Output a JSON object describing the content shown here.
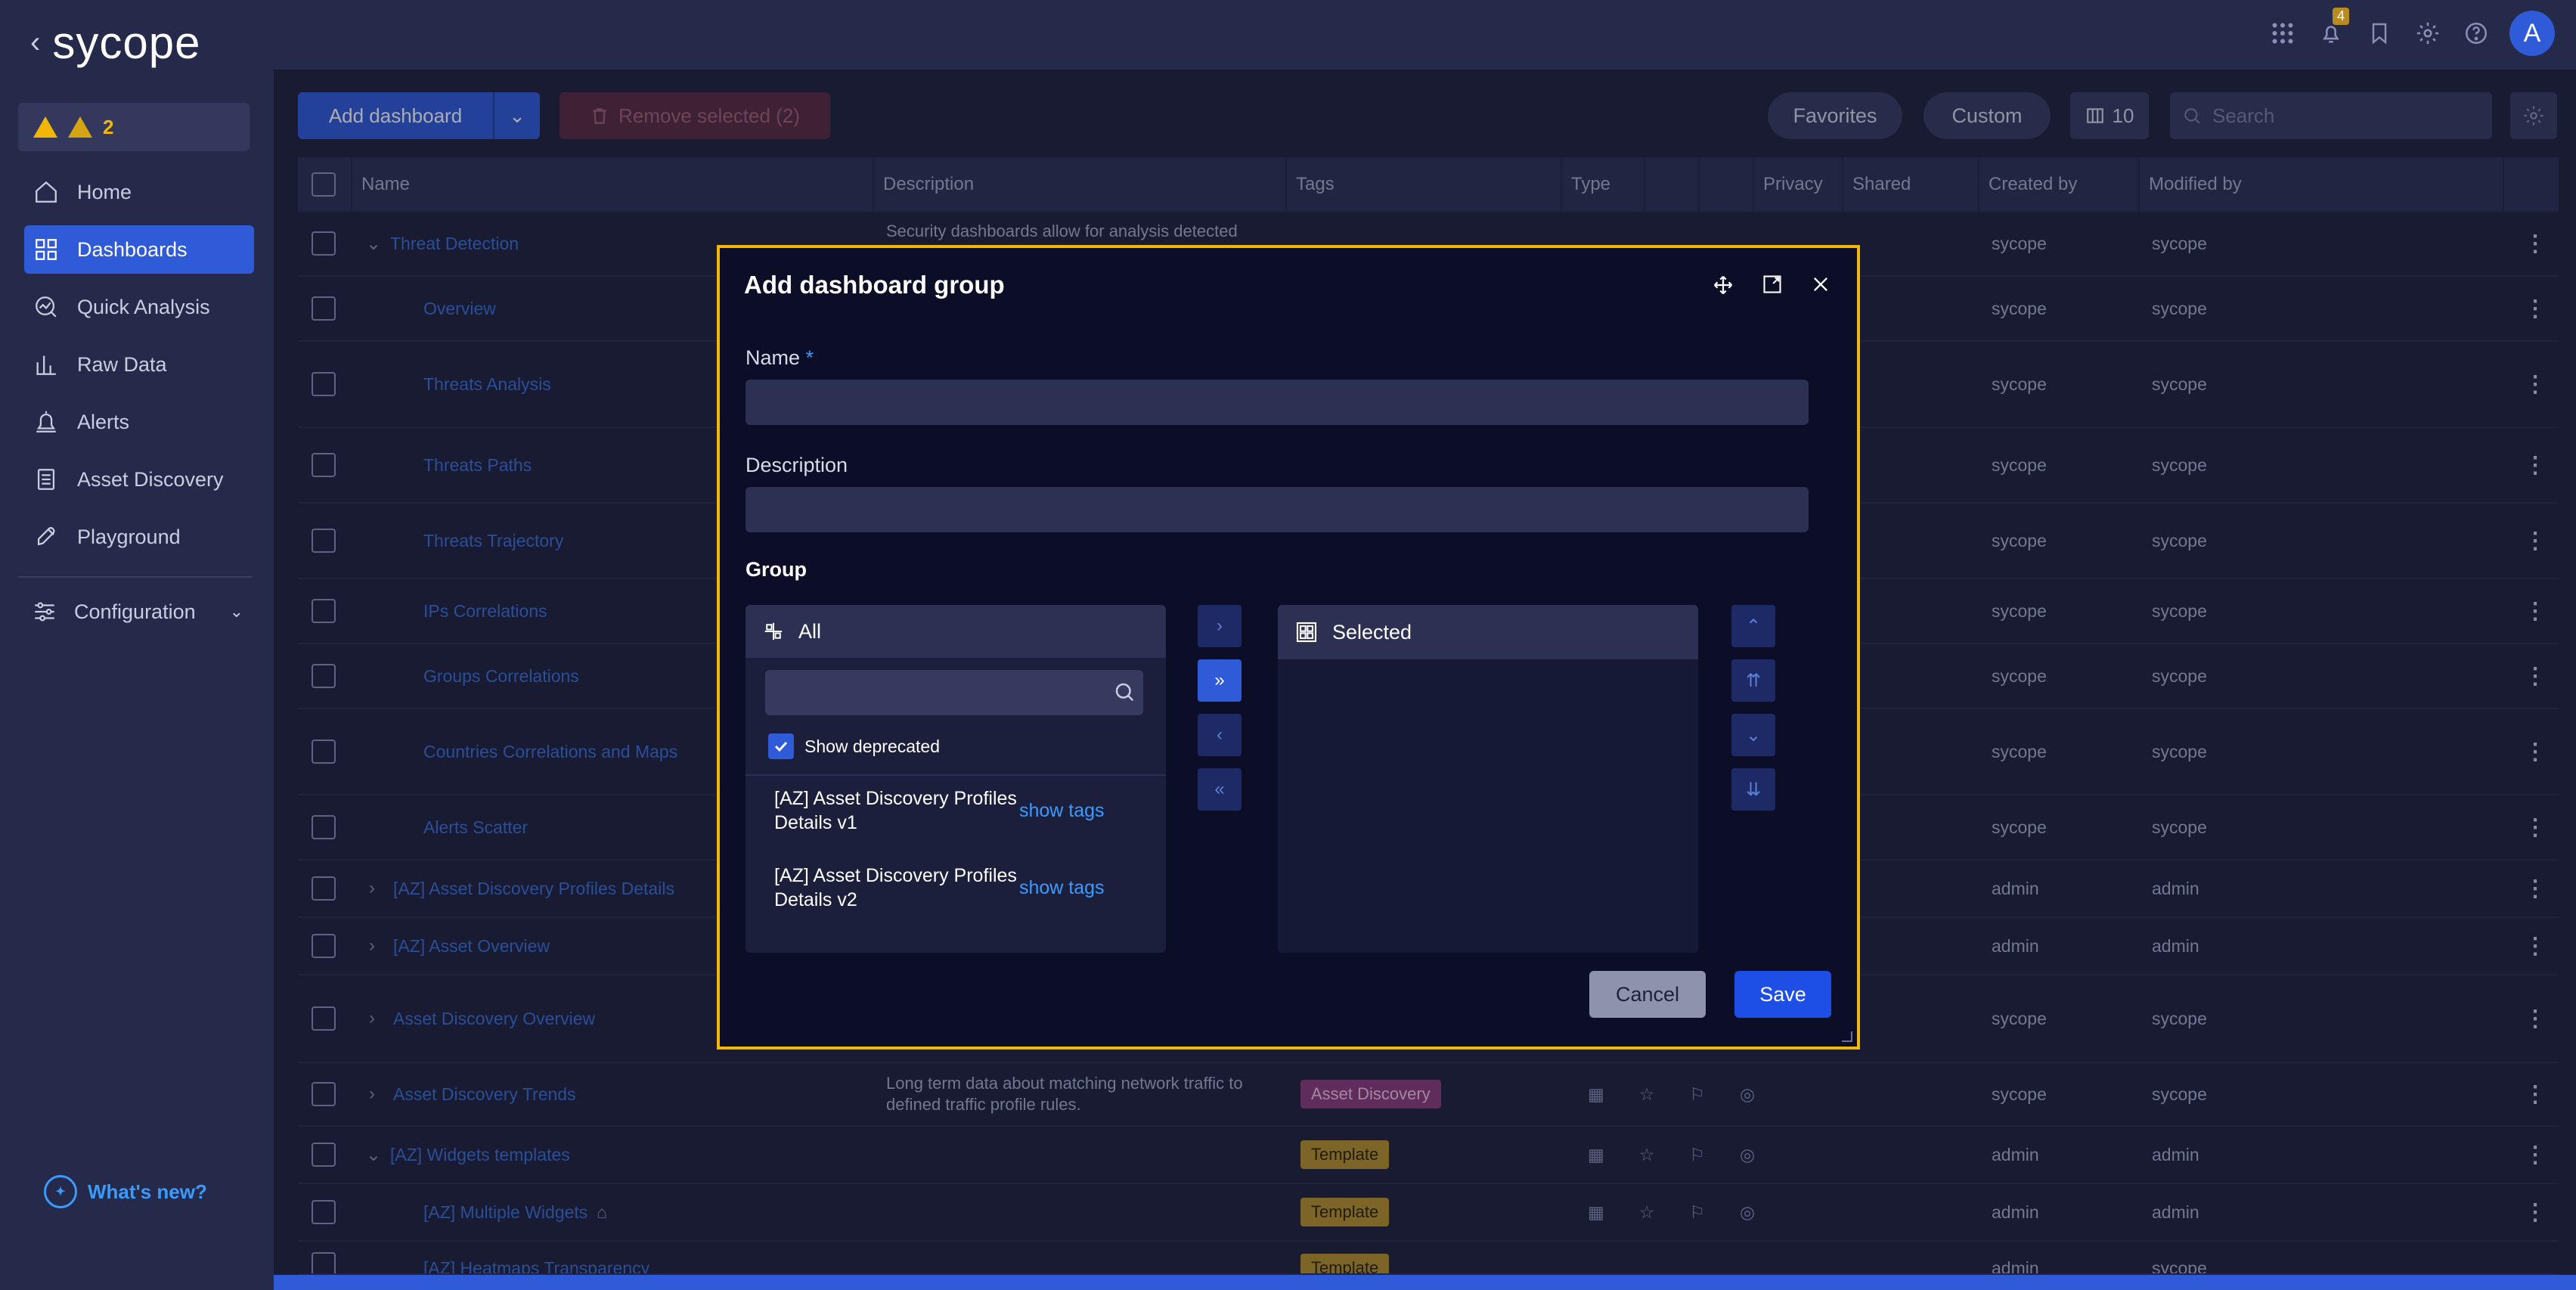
{
  "app": {
    "logo_text": "sycope",
    "alerts_count": "2",
    "notifications_count": "4",
    "avatar_letter": "A"
  },
  "sidebar": {
    "items": [
      {
        "label": "Home",
        "icon": "home-icon"
      },
      {
        "label": "Dashboards",
        "icon": "dashboards-icon"
      },
      {
        "label": "Quick Analysis",
        "icon": "quick-analysis-icon"
      },
      {
        "label": "Raw Data",
        "icon": "raw-data-icon"
      },
      {
        "label": "Alerts",
        "icon": "alerts-icon"
      },
      {
        "label": "Asset Discovery",
        "icon": "asset-discovery-icon"
      },
      {
        "label": "Playground",
        "icon": "playground-icon"
      }
    ],
    "configuration_label": "Configuration",
    "whats_new_label": "What's new?"
  },
  "toolbar": {
    "add_dashboard_label": "Add dashboard",
    "remove_selected_label": "Remove selected (2)",
    "favorites_label": "Favorites",
    "custom_label": "Custom",
    "columns_count": "10",
    "search_placeholder": "Search"
  },
  "table": {
    "headers": [
      "Name",
      "Description",
      "Tags",
      "Type",
      "Privacy",
      "Shared",
      "Created by",
      "Modified by"
    ],
    "rows": [
      {
        "name": "Threat Detection",
        "desc": "Security dashboards allow for analysis detected",
        "created": "sycope",
        "modified": "sycope"
      },
      {
        "name": "Overview",
        "created": "sycope",
        "modified": "sycope"
      },
      {
        "name": "Threats Analysis",
        "created": "sycope",
        "modified": "sycope"
      },
      {
        "name": "Threats Paths",
        "created": "sycope",
        "modified": "sycope"
      },
      {
        "name": "Threats Trajectory",
        "created": "sycope",
        "modified": "sycope"
      },
      {
        "name": "IPs Correlations",
        "created": "sycope",
        "modified": "sycope"
      },
      {
        "name": "Groups Correlations",
        "created": "sycope",
        "modified": "sycope"
      },
      {
        "name": "Countries Correlations and Maps",
        "created": "sycope",
        "modified": "sycope"
      },
      {
        "name": "Alerts Scatter",
        "created": "sycope",
        "modified": "sycope"
      },
      {
        "name": "[AZ] Asset Discovery Profiles Details",
        "created": "admin",
        "modified": "admin"
      },
      {
        "name": "[AZ] Asset Overview",
        "created": "admin",
        "modified": "admin"
      },
      {
        "name": "Asset Discovery Overview",
        "created": "sycope",
        "modified": "sycope"
      },
      {
        "name": "Asset Discovery Trends",
        "desc": "Long term data about matching network traffic to defined traffic profile rules.",
        "tag": "Asset Discovery",
        "created": "sycope",
        "modified": "sycope"
      },
      {
        "name": "[AZ] Widgets templates",
        "tag": "Template",
        "created": "admin",
        "modified": "admin"
      },
      {
        "name": "[AZ] Multiple Widgets",
        "tag": "Template",
        "created": "admin",
        "modified": "admin"
      },
      {
        "name": "[AZ] Heatmaps Transparency",
        "tag": "Template",
        "created": "admin",
        "modified": "sycope"
      }
    ]
  },
  "modal": {
    "title": "Add dashboard group",
    "name_label": "Name",
    "required_mark": "*",
    "description_label": "Description",
    "group_label": "Group",
    "all_label": "All",
    "selected_label": "Selected",
    "show_deprecated_label": "Show deprecated",
    "available_items": [
      {
        "name": "[AZ] Asset Discovery Profiles Details v1",
        "action": "show tags"
      },
      {
        "name": "[AZ] Asset Discovery Profiles Details v2",
        "action": "show tags"
      }
    ],
    "cancel_label": "Cancel",
    "save_label": "Save"
  }
}
